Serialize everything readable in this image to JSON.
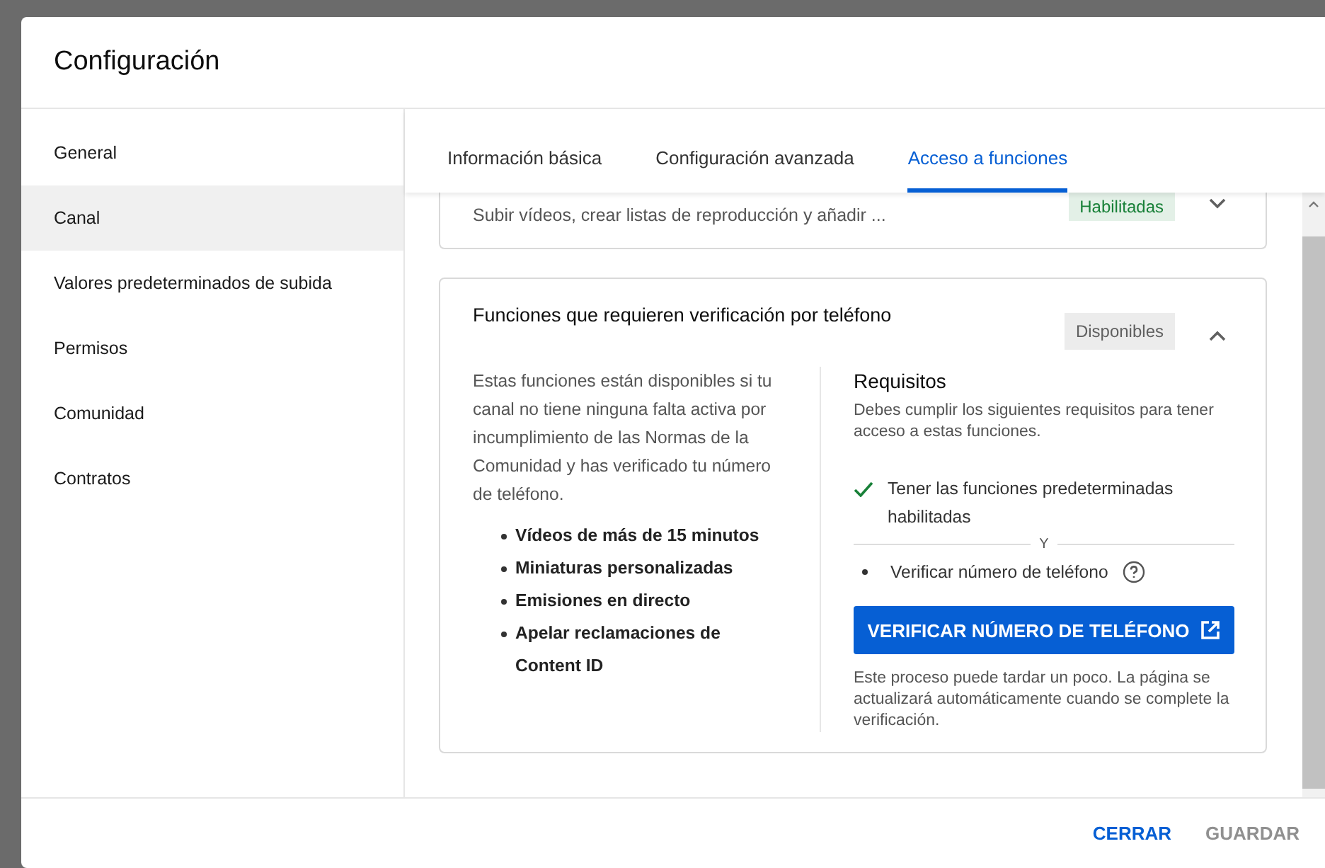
{
  "dialog": {
    "title": "Configuración"
  },
  "sidebar": {
    "items": [
      {
        "label": "General",
        "selected": false
      },
      {
        "label": "Canal",
        "selected": true
      },
      {
        "label": "Valores predeterminados de subida",
        "selected": false
      },
      {
        "label": "Permisos",
        "selected": false
      },
      {
        "label": "Comunidad",
        "selected": false
      },
      {
        "label": "Contratos",
        "selected": false
      }
    ]
  },
  "tabs": [
    {
      "label": "Información básica",
      "selected": false
    },
    {
      "label": "Configuración avanzada",
      "selected": false
    },
    {
      "label": "Acceso a funciones",
      "selected": true
    }
  ],
  "cards": [
    {
      "description": "Subir vídeos, crear listas de reproducción y añadir ...",
      "status": "Habilitadas",
      "color": "#188038",
      "expanded": false
    },
    {
      "title": "Funciones que requieren verificación por teléfono",
      "status": "Disponibles",
      "color": "#606060",
      "expanded": true,
      "intro": "Estas funciones están disponibles si tu canal no tiene ninguna falta activa por incumplimiento de las Normas de la Comunidad y has verificado tu número de teléfono.",
      "features": [
        "Vídeos de más de 15 minutos",
        "Miniaturas personalizadas",
        "Emisiones en directo",
        "Apelar reclamaciones de Content ID"
      ],
      "requirements": {
        "title": "Requisitos",
        "description": "Debes cumplir los siguientes requisitos para tener acceso a estas funciones.",
        "items": [
          {
            "kind": "met",
            "text": "Tener las funciones predeterminadas habilitadas"
          },
          {
            "kind": "separator",
            "text": "Y"
          },
          {
            "kind": "pending",
            "text": "Verificar número de teléfono",
            "help": true
          }
        ],
        "action": "VERIFICAR NÚMERO DE TELÉFONO",
        "note": "Este proceso puede tardar un poco. La página se actualizará automáticamente cuando se complete la verificación."
      }
    }
  ],
  "footer": {
    "buttons": [
      {
        "label": "CERRAR",
        "disabled": false
      },
      {
        "label": "GUARDAR",
        "disabled": true
      }
    ]
  }
}
